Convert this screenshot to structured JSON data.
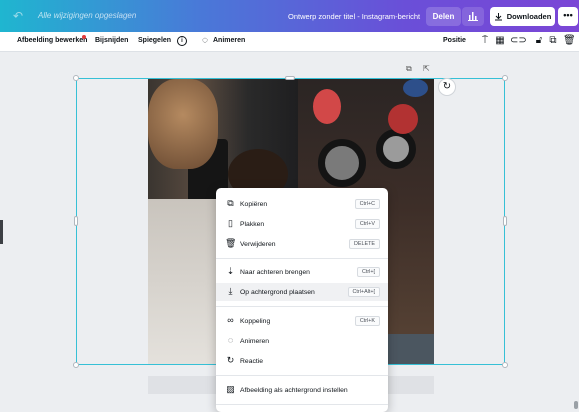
{
  "topbar": {
    "saved_status": "Alle wijzigingen opgeslagen",
    "document_title": "Ontwerp zonder titel - Instagram-bericht",
    "share_label": "Delen",
    "download_label": "Downloaden",
    "more_label": "•••"
  },
  "toolbar": {
    "edit_image_label": "Afbeelding bewerken",
    "crop_label": "Bijsnijden",
    "flip_label": "Spiegelen",
    "info_label": "i",
    "animate_label": "Animeren",
    "position_label": "Positie"
  },
  "context_menu": {
    "groups": [
      [
        {
          "icon": "copy-icon",
          "label": "Kopiëren",
          "shortcut": "Ctrl+C"
        },
        {
          "icon": "paste-icon",
          "label": "Plakken",
          "shortcut": "Ctrl+V"
        },
        {
          "icon": "trash-icon",
          "label": "Verwijderen",
          "shortcut": "DELETE"
        }
      ],
      [
        {
          "icon": "send-backward-icon",
          "label": "Naar achteren brengen",
          "shortcut": "Ctrl+["
        },
        {
          "icon": "send-to-back-icon",
          "label": "Op achtergrond plaatsen",
          "shortcut": "Ctrl+Alt+["
        }
      ],
      [
        {
          "icon": "link-icon",
          "label": "Koppeling",
          "shortcut": "Ctrl+K"
        },
        {
          "icon": "animate-icon",
          "label": "Animeren",
          "shortcut": ""
        },
        {
          "icon": "comment-icon",
          "label": "Reactie",
          "shortcut": ""
        }
      ],
      [
        {
          "icon": "set-background-icon",
          "label": "Afbeelding als achtergrond instellen",
          "shortcut": ""
        }
      ]
    ],
    "hovered": "Op achtergrond plaatsen"
  }
}
